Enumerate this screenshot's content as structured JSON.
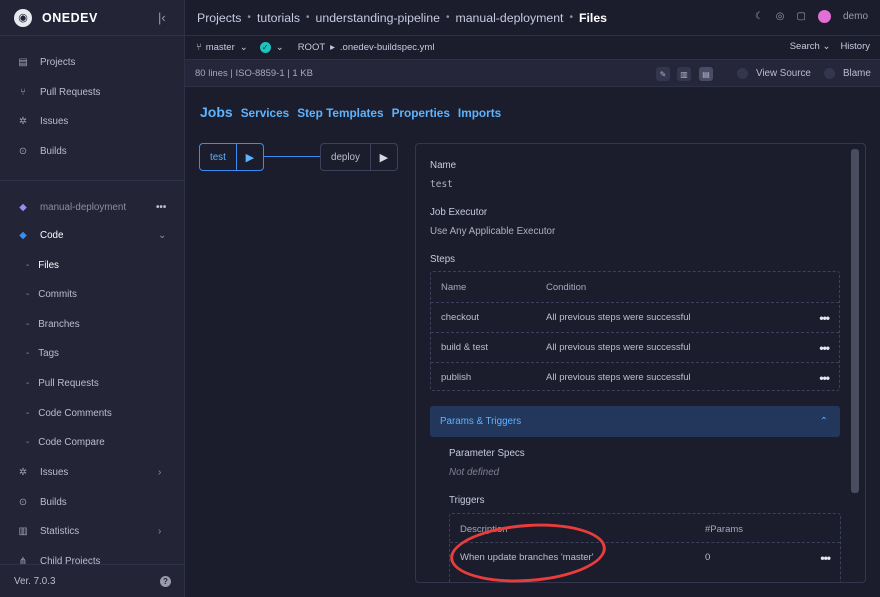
{
  "brand": {
    "name": "ONEDEV"
  },
  "sidebar": {
    "main_items": [
      {
        "label": "Projects"
      },
      {
        "label": "Pull Requests"
      },
      {
        "label": "Issues"
      },
      {
        "label": "Builds"
      }
    ],
    "project": {
      "label": "manual-deployment"
    },
    "code": {
      "label": "Code"
    },
    "code_items": [
      {
        "label": "Files"
      },
      {
        "label": "Commits"
      },
      {
        "label": "Branches"
      },
      {
        "label": "Tags"
      },
      {
        "label": "Pull Requests"
      },
      {
        "label": "Code Comments"
      },
      {
        "label": "Code Compare"
      }
    ],
    "project_items": [
      {
        "label": "Issues"
      },
      {
        "label": "Builds"
      },
      {
        "label": "Statistics"
      },
      {
        "label": "Child Projects"
      }
    ],
    "version": "Ver. 7.0.3"
  },
  "breadcrumb": [
    "Projects",
    "tutorials",
    "understanding-pipeline",
    "manual-deployment",
    "Files"
  ],
  "user": {
    "name": "demo"
  },
  "toolbar": {
    "branch": "master",
    "root": "ROOT",
    "file": ".onedev-buildspec.yml",
    "search": "Search",
    "history": "History"
  },
  "file_info": {
    "meta": "80 lines | ISO-8859-1 | 1 KB",
    "view_source": "View Source",
    "blame": "Blame"
  },
  "tabs": [
    "Jobs",
    "Services",
    "Step Templates",
    "Properties",
    "Imports"
  ],
  "jobs": [
    {
      "name": "test"
    },
    {
      "name": "deploy"
    }
  ],
  "detail": {
    "name_label": "Name",
    "name_value": "test",
    "executor_label": "Job Executor",
    "executor_value": "Use Any Applicable Executor",
    "steps_label": "Steps",
    "steps_columns": [
      "Name",
      "Condition"
    ],
    "steps": [
      {
        "name": "checkout",
        "condition": "All previous steps were successful"
      },
      {
        "name": "build & test",
        "condition": "All previous steps were successful"
      },
      {
        "name": "publish",
        "condition": "All previous steps were successful"
      }
    ],
    "params_triggers": "Params & Triggers",
    "param_specs_label": "Parameter Specs",
    "param_specs_value": "Not defined",
    "triggers_label": "Triggers",
    "trigger_columns": [
      "Description",
      "#Params"
    ],
    "triggers": [
      {
        "description": "When update branches 'master'",
        "params": "0"
      }
    ]
  },
  "colors": {
    "accent": "#5db3ff",
    "annotation": "#e93d3d",
    "background": "#1c1d2c"
  }
}
